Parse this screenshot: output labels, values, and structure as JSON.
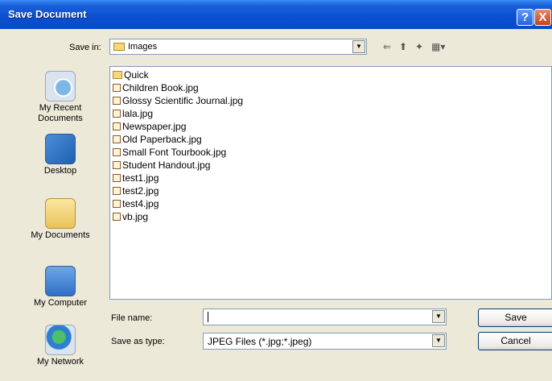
{
  "window": {
    "title": "Save Document",
    "help_label": "?",
    "close_label": "X"
  },
  "save_in": {
    "label": "Save in:",
    "value": "Images"
  },
  "places": [
    {
      "label": "My Recent Documents",
      "icon": "recent-documents-icon"
    },
    {
      "label": "Desktop",
      "icon": "desktop-icon"
    },
    {
      "label": "My Documents",
      "icon": "my-documents-icon"
    },
    {
      "label": "My Computer",
      "icon": "my-computer-icon"
    },
    {
      "label": "My Network",
      "icon": "my-network-icon"
    }
  ],
  "files": [
    {
      "name": "Quick",
      "type": "folder"
    },
    {
      "name": "Children Book.jpg",
      "type": "jpg"
    },
    {
      "name": "Glossy Scientific Journal.jpg",
      "type": "jpg"
    },
    {
      "name": "lala.jpg",
      "type": "jpg"
    },
    {
      "name": "Newspaper.jpg",
      "type": "jpg"
    },
    {
      "name": "Old Paperback.jpg",
      "type": "jpg"
    },
    {
      "name": "Small Font Tourbook.jpg",
      "type": "jpg"
    },
    {
      "name": "Student Handout.jpg",
      "type": "jpg"
    },
    {
      "name": "test1.jpg",
      "type": "jpg"
    },
    {
      "name": "test2.jpg",
      "type": "jpg"
    },
    {
      "name": "test4.jpg",
      "type": "jpg"
    },
    {
      "name": "vb.jpg",
      "type": "jpg"
    }
  ],
  "file_name": {
    "label": "File name:",
    "value": ""
  },
  "save_as_type": {
    "label": "Save as type:",
    "value": "JPEG Files (*.jpg;*.jpeg)"
  },
  "buttons": {
    "save": "Save",
    "cancel": "Cancel"
  },
  "dropdown_glyph": "▼",
  "toolbar_glyphs": {
    "back": "⇐",
    "up": "⬆",
    "new_folder": "✦",
    "views": "▦▾"
  },
  "colors": {
    "titlebar": "#0A4FCF",
    "dialog_bg": "#ECE9D8"
  }
}
